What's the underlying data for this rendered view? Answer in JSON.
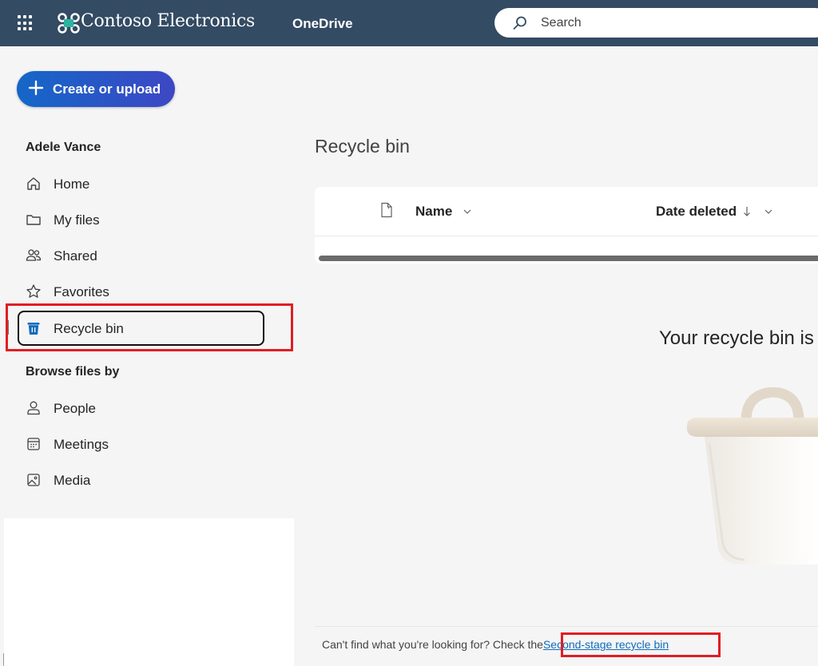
{
  "app": {
    "brand": "Contoso Electronics",
    "app_name": "OneDrive",
    "accent": "#334b63"
  },
  "search": {
    "placeholder": "Search",
    "icon": "search-icon"
  },
  "sidebar": {
    "create_label": "Create or upload",
    "user_name": "Adele Vance",
    "items": [
      {
        "label": "Home",
        "icon": "home-icon"
      },
      {
        "label": "My files",
        "icon": "folder-icon"
      },
      {
        "label": "Shared",
        "icon": "people-icon"
      },
      {
        "label": "Favorites",
        "icon": "star-icon"
      },
      {
        "label": "Recycle bin",
        "icon": "recycle-bin-icon",
        "selected": true
      }
    ],
    "browse_title": "Browse files by",
    "browse_items": [
      {
        "label": "People",
        "icon": "person-icon"
      },
      {
        "label": "Meetings",
        "icon": "calendar-icon"
      },
      {
        "label": "Media",
        "icon": "image-icon"
      }
    ]
  },
  "main": {
    "title": "Recycle bin",
    "columns": {
      "name": "Name",
      "date_deleted": "Date deleted",
      "sort_indicator": "↓"
    },
    "empty_message": "Your recycle bin is"
  },
  "footer": {
    "text": "Can't find what you're looking for? Check the",
    "link": "Second-stage recycle bin"
  }
}
